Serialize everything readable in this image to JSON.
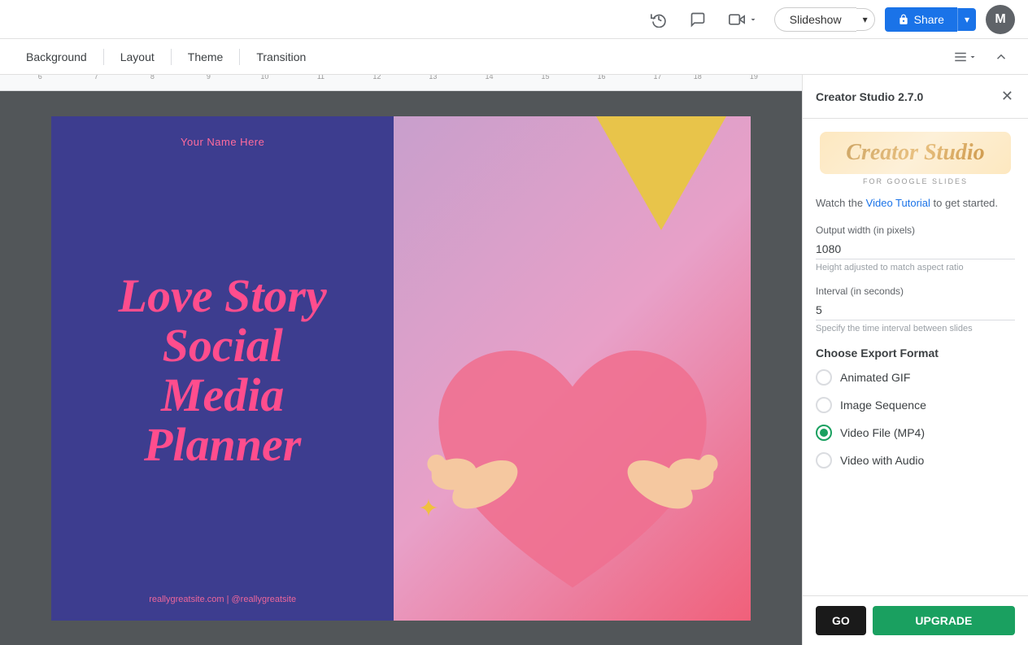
{
  "toolbar": {
    "slideshow_label": "Slideshow",
    "share_label": "Share",
    "avatar_initial": "M",
    "camera_icon": "📷",
    "history_icon": "⏱",
    "comment_icon": "💬"
  },
  "secondary_toolbar": {
    "background_label": "Background",
    "layout_label": "Layout",
    "theme_label": "Theme",
    "transition_label": "Transition"
  },
  "ruler": {
    "marks": [
      "6",
      "7",
      "8",
      "9",
      "10",
      "11",
      "12",
      "13",
      "14",
      "15",
      "16",
      "17",
      "18",
      "19"
    ]
  },
  "slide": {
    "name": "Your Name Here",
    "title": "Love Story Social Media Planner",
    "footer": "reallygreatsite.com  |  @reallygreatsite"
  },
  "panel": {
    "title": "Creator Studio 2.7.0",
    "close_icon": "✕",
    "logo_text": "Creator Studio",
    "logo_subtitle": "FOR GOOGLE SLIDES",
    "description_before_link": "Watch the ",
    "link_text": "Video Tutorial",
    "description_after_link": " to get started.",
    "output_width_label": "Output width (in pixels)",
    "output_width_value": "1080",
    "output_width_hint": "Height adjusted to match aspect ratio",
    "interval_label": "Interval (in seconds)",
    "interval_value": "5",
    "interval_hint": "Specify the time interval between slides",
    "export_section_title": "Choose Export Format",
    "export_options": [
      {
        "id": "animated-gif",
        "label": "Animated GIF",
        "checked": false
      },
      {
        "id": "image-sequence",
        "label": "Image Sequence",
        "checked": false
      },
      {
        "id": "video-mp4",
        "label": "Video File (MP4)",
        "checked": true
      },
      {
        "id": "video-audio",
        "label": "Video with Audio",
        "checked": false
      }
    ],
    "go_label": "GO",
    "upgrade_label": "UPGRADE"
  }
}
